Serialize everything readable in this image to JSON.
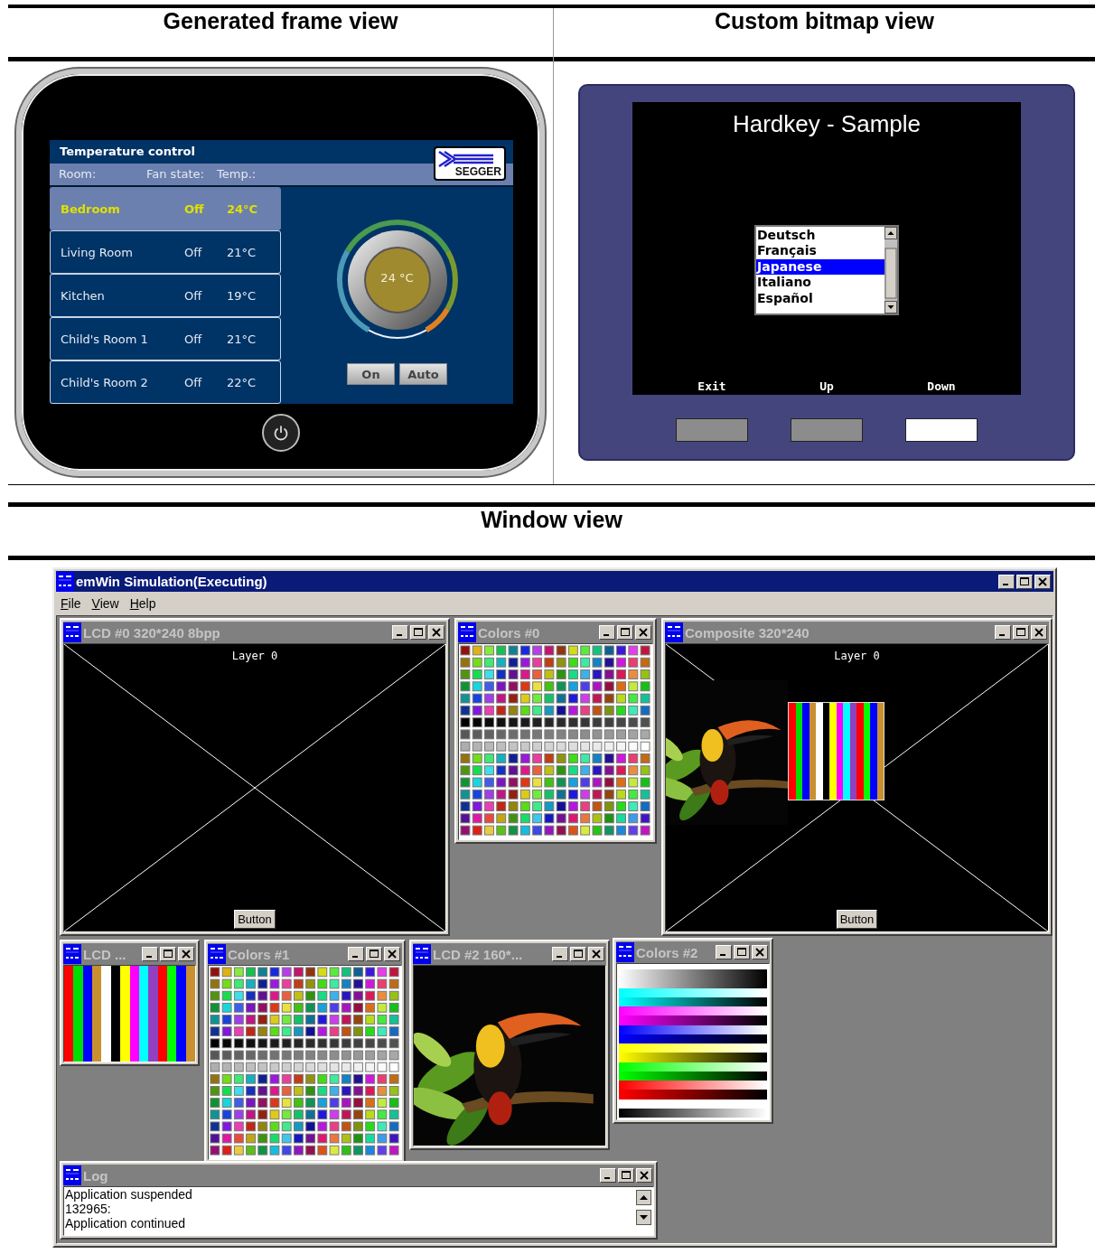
{
  "frame_view": {
    "heading": "Generated frame view",
    "thermostat": {
      "title": "Temperature control",
      "columns": [
        "Room:",
        "Fan state:",
        "Temp.:"
      ],
      "logo_text": "SEGGER",
      "rooms": [
        {
          "name": "Bedroom",
          "fan": "Off",
          "temp": "24°C",
          "selected": true
        },
        {
          "name": "Living Room",
          "fan": "Off",
          "temp": "21°C",
          "selected": false
        },
        {
          "name": "Kitchen",
          "fan": "Off",
          "temp": "19°C",
          "selected": false
        },
        {
          "name": "Child's Room 1",
          "fan": "Off",
          "temp": "21°C",
          "selected": false
        },
        {
          "name": "Child's Room 2",
          "fan": "Off",
          "temp": "22°C",
          "selected": false
        }
      ],
      "dial_value": "24 °C",
      "buttons": [
        "On",
        "Auto"
      ]
    }
  },
  "bitmap_view": {
    "heading": "Custom bitmap view",
    "title": "Hardkey - Sample",
    "languages": [
      {
        "label": "Deutsch",
        "selected": false
      },
      {
        "label": "Français",
        "selected": false
      },
      {
        "label": "Japanese",
        "selected": true
      },
      {
        "label": "Italiano",
        "selected": false
      },
      {
        "label": "Español",
        "selected": false
      }
    ],
    "softkeys": [
      "Exit",
      "Up",
      "Down"
    ],
    "hard_keys": [
      {
        "pressed": false
      },
      {
        "pressed": false
      },
      {
        "pressed": true
      }
    ]
  },
  "window_view": {
    "heading": "Window view",
    "title": "emWin Simulation(Executing)",
    "menu": [
      "File",
      "View",
      "Help"
    ],
    "windows": [
      {
        "kind": "lcd",
        "title": "LCD #0 320*240 8bpp",
        "layer_label": "Layer 0",
        "button": "Button"
      },
      {
        "kind": "palette",
        "title": "Colors #0"
      },
      {
        "kind": "composite",
        "title": "Composite 320*240",
        "layer_label": "Layer 0",
        "button": "Button"
      },
      {
        "kind": "bars",
        "title": "LCD ..."
      },
      {
        "kind": "palette",
        "title": "Colors #1"
      },
      {
        "kind": "picture",
        "title": "LCD #2 160*..."
      },
      {
        "kind": "gradients",
        "title": "Colors #2"
      },
      {
        "kind": "log",
        "title": "Log",
        "lines": [
          "Application suspended",
          "132965:",
          "Application continued"
        ]
      }
    ]
  }
}
